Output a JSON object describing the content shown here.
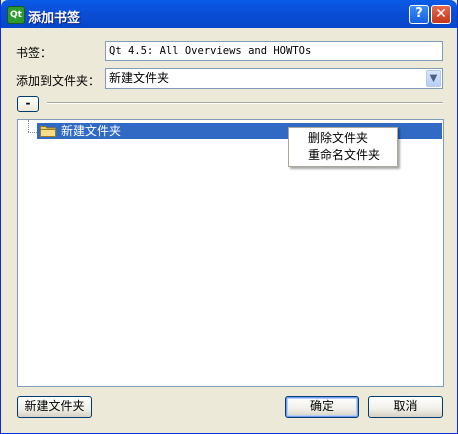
{
  "window": {
    "title": "添加书签",
    "app_icon_text": "Qt",
    "help_button": "?",
    "close_button": "✕"
  },
  "form": {
    "bookmark_label": "书签：",
    "bookmark_value": "Qt 4.5: All Overviews and HOWTOs",
    "folder_label": "添加到文件夹：",
    "folder_selected": "新建文件夹",
    "toggle_label": "-"
  },
  "tree": {
    "items": [
      {
        "label": "新建文件夹",
        "selected": true
      }
    ]
  },
  "context_menu": {
    "items": [
      {
        "label": "删除文件夹"
      },
      {
        "label": "重命名文件夹"
      }
    ]
  },
  "buttons": {
    "new_folder": "新建文件夹",
    "ok": "确定",
    "cancel": "取消"
  },
  "colors": {
    "selection": "#316ac5",
    "titlebar": "#0b4fd9"
  }
}
